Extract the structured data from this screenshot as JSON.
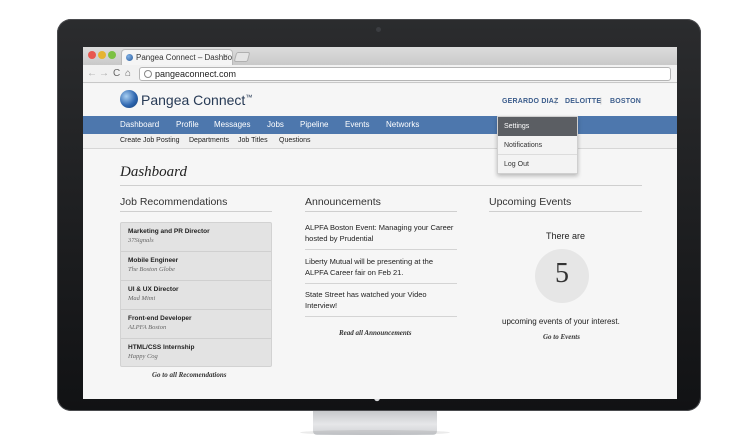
{
  "browser": {
    "tab_title": "Pangea Connect – Dashboa",
    "tab_close": "×",
    "url": "pangeaconnect.com",
    "nav": {
      "back": "←",
      "forward": "→",
      "reload": "C",
      "home": "⌂"
    }
  },
  "header": {
    "logo_text": "Pangea Connect",
    "logo_tm": "™",
    "user": "GERARDO DIAZ",
    "separator": "|",
    "org": "DELOITTE",
    "city": "BOSTON"
  },
  "user_menu": {
    "items": [
      "Settings",
      "Notifications",
      "Log Out"
    ],
    "active": "Settings"
  },
  "main_nav": [
    "Dashboard",
    "Profile",
    "Messages",
    "Jobs",
    "Pipeline",
    "Events",
    "Networks"
  ],
  "sub_nav": [
    "Create Job Posting",
    "Departments",
    "Job Titles",
    "Questions"
  ],
  "page_title": "Dashboard",
  "job_recommendations": {
    "heading": "Job Recommendations",
    "items": [
      {
        "title": "Marketing and PR Director",
        "company": "37Signals"
      },
      {
        "title": "Mobile Engineer",
        "company": "The Boston Globe"
      },
      {
        "title": "UI & UX Director",
        "company": "Mad Mimi"
      },
      {
        "title": "Front-end Developer",
        "company": "ALPFA Boston"
      },
      {
        "title": "HTML/CSS Internship",
        "company": "Happy Cog"
      }
    ],
    "link": "Go to all Recomendations"
  },
  "announcements": {
    "heading": "Announcements",
    "items": [
      "ALPFA Boston Event: Managing your Career hosted by Prudential",
      "Liberty Mutual will be presenting at the ALPFA Career fair on Feb 21.",
      "State Street has watched your Video Interview!"
    ],
    "link": "Read all Announcements"
  },
  "upcoming_events": {
    "heading": "Upcoming Events",
    "there_are": "There are",
    "count": "5",
    "text": "upcoming events of your interest.",
    "link": "Go to Events"
  },
  "colors": {
    "nav_bar": "#4d77ad",
    "link_blue": "#3c5d8c",
    "active_menu": "#5b5e63"
  }
}
